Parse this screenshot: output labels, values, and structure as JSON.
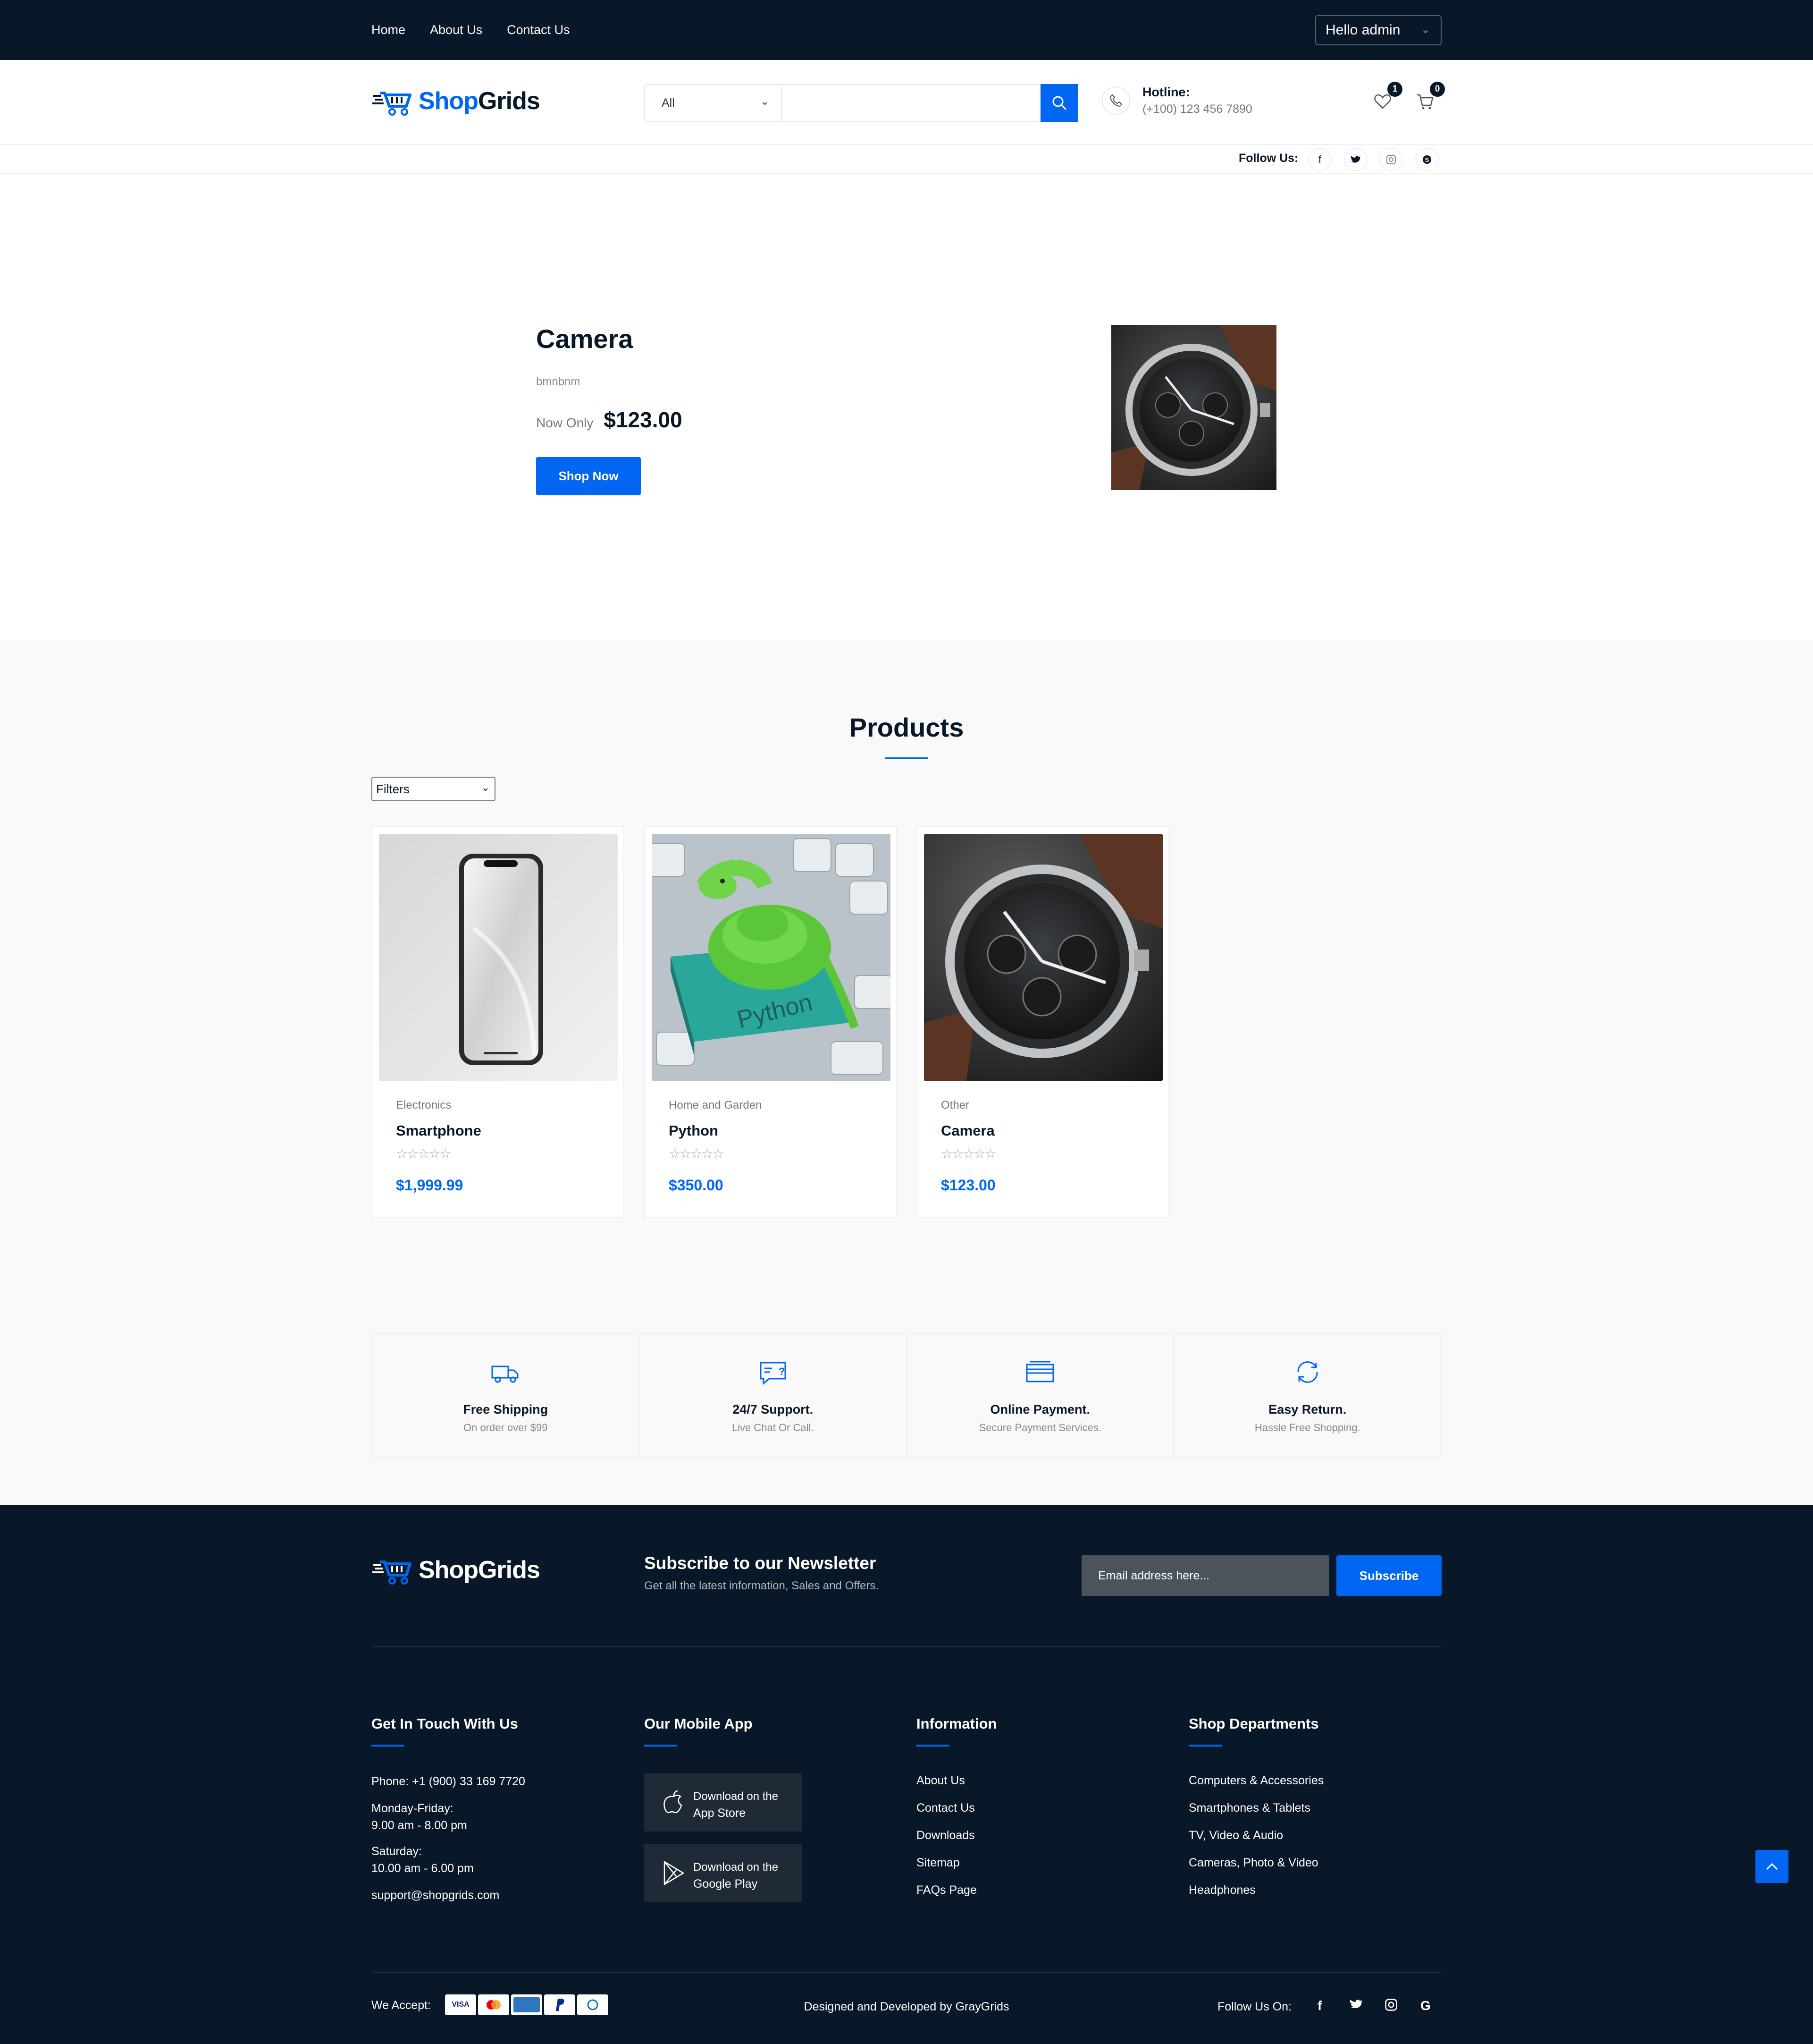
{
  "topbar": {
    "nav": [
      "Home",
      "About Us",
      "Contact Us"
    ],
    "user_greeting": "Hello admin"
  },
  "header": {
    "logo_part1": "Shop",
    "logo_part2": "Grids",
    "search": {
      "category": "All",
      "placeholder": ""
    },
    "hotline_label": "Hotline:",
    "hotline_number": "(+100) 123 456 7890",
    "wishlist_count": "1",
    "cart_count": "0",
    "follow_label": "Follow Us:"
  },
  "hero": {
    "title": "Camera",
    "description": "bmnbnm",
    "price_prefix": "Now Only",
    "price": "$123.00",
    "button": "Shop Now"
  },
  "products": {
    "title": "Products",
    "filter_label": "Filters",
    "items": [
      {
        "category": "Electronics",
        "name": "Smartphone",
        "rating": 0,
        "stars": "☆☆☆☆☆",
        "price": "$1,999.99"
      },
      {
        "category": "Home and Garden",
        "name": "Python",
        "rating": 0,
        "stars": "☆☆☆☆☆",
        "price": "$350.00"
      },
      {
        "category": "Other",
        "name": "Camera",
        "rating": 0,
        "stars": "☆☆☆☆☆",
        "price": "$123.00"
      }
    ]
  },
  "features": [
    {
      "title": "Free Shipping",
      "subtitle": "On order over $99",
      "icon": "truck-icon"
    },
    {
      "title": "24/7 Support.",
      "subtitle": "Live Chat Or Call.",
      "icon": "chat-icon"
    },
    {
      "title": "Online Payment.",
      "subtitle": "Secure Payment Services.",
      "icon": "credit-card-icon"
    },
    {
      "title": "Easy Return.",
      "subtitle": "Hassle Free Shopping.",
      "icon": "refresh-icon"
    }
  ],
  "footer": {
    "newsletter_title": "Subscribe to our Newsletter",
    "newsletter_sub": "Get all the latest information, Sales and Offers.",
    "email_placeholder": "Email address here...",
    "subscribe": "Subscribe",
    "contact": {
      "title": "Get In Touch With Us",
      "phone": "Phone: +1 (900) 33 169 7720",
      "weekday_label": "Monday-Friday:",
      "weekday_hours": "9.00 am - 8.00 pm",
      "saturday_label": "Saturday:",
      "saturday_hours": "10.00 am - 6.00 pm",
      "email": "support@shopgrids.com"
    },
    "app": {
      "title": "Our Mobile App",
      "appstore_l1": "Download on the",
      "appstore_l2": "App Store",
      "play_l1": "Download on the",
      "play_l2": "Google Play"
    },
    "information": {
      "title": "Information",
      "links": [
        "About Us",
        "Contact Us",
        "Downloads",
        "Sitemap",
        "FAQs Page"
      ]
    },
    "departments": {
      "title": "Shop Departments",
      "links": [
        "Computers & Accessories",
        "Smartphones & Tablets",
        "TV, Video & Audio",
        "Cameras, Photo & Video",
        "Headphones"
      ]
    },
    "accept_label": "We Accept:",
    "cards": [
      "VISA",
      "MC",
      "AMEX",
      "PP",
      "DC"
    ],
    "credit": "Designed and Developed by GrayGrids",
    "follow_label": "Follow Us On:"
  },
  "colors": {
    "accent": "#0167F3",
    "dark": "#081828"
  }
}
